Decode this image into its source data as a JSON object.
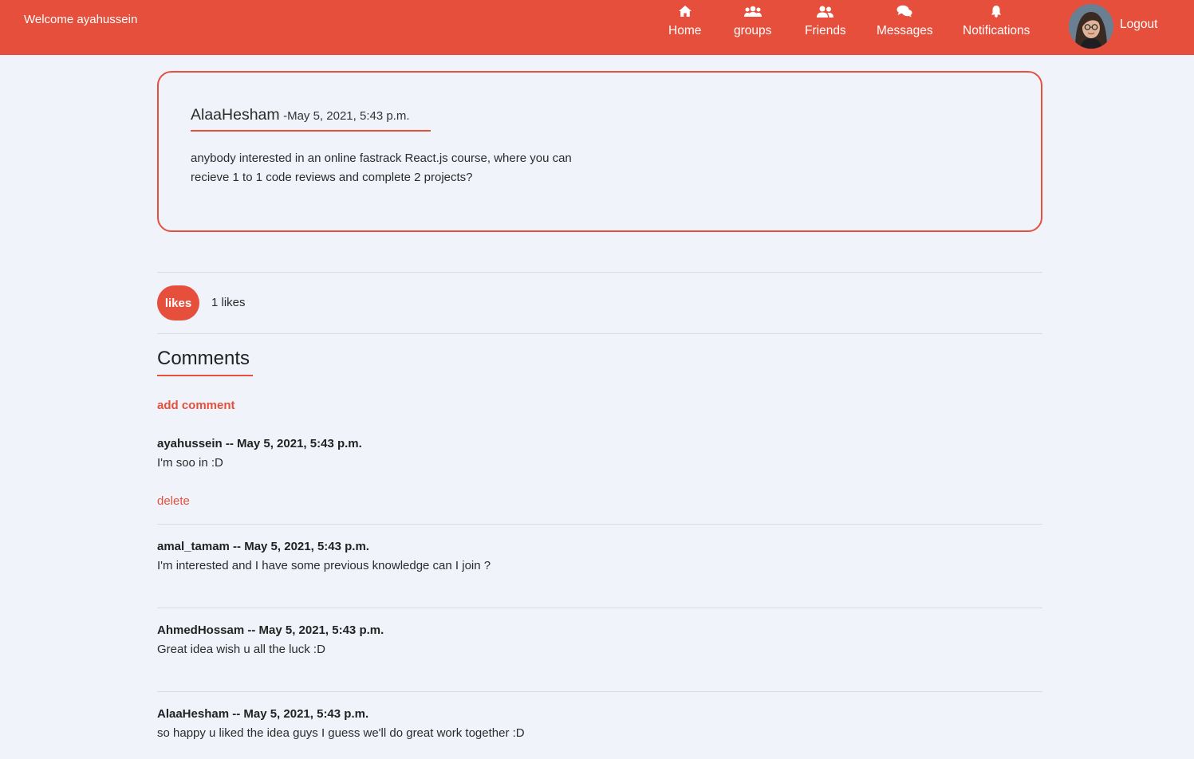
{
  "header": {
    "welcome": "Welcome ayahussein",
    "nav": [
      {
        "label": "Home",
        "icon": "home-icon"
      },
      {
        "label": "groups",
        "icon": "users-icon"
      },
      {
        "label": "Friends",
        "icon": "user-friends-icon"
      },
      {
        "label": "Messages",
        "icon": "comments-icon"
      },
      {
        "label": "Notifications",
        "icon": "bell-icon"
      }
    ],
    "logout": "Logout",
    "accent_color": "#e54f3c"
  },
  "post": {
    "author": "AlaaHesham",
    "date": "-May 5, 2021, 5:43 p.m.",
    "text": "anybody interested in an online fastrack React.js course, where you can recieve 1 to 1 code reviews and complete 2 projects?"
  },
  "likes": {
    "button_label": "likes",
    "count_text": "1 likes"
  },
  "comments": {
    "title": "Comments",
    "add_label": "add comment",
    "delete_label": "delete",
    "items": [
      {
        "header": "ayahussein -- May 5, 2021, 5:43 p.m.",
        "text": "I'm soo in :D"
      },
      {
        "header": "amal_tamam -- May 5, 2021, 5:43 p.m.",
        "text": "I'm interested and I have some previous knowledge can I join ?"
      },
      {
        "header": "AhmedHossam -- May 5, 2021, 5:43 p.m.",
        "text": "Great idea wish u all the luck :D"
      },
      {
        "header": "AlaaHesham -- May 5, 2021, 5:43 p.m.",
        "text": "so happy u liked the idea guys I guess we'll do great work together :D"
      }
    ]
  }
}
